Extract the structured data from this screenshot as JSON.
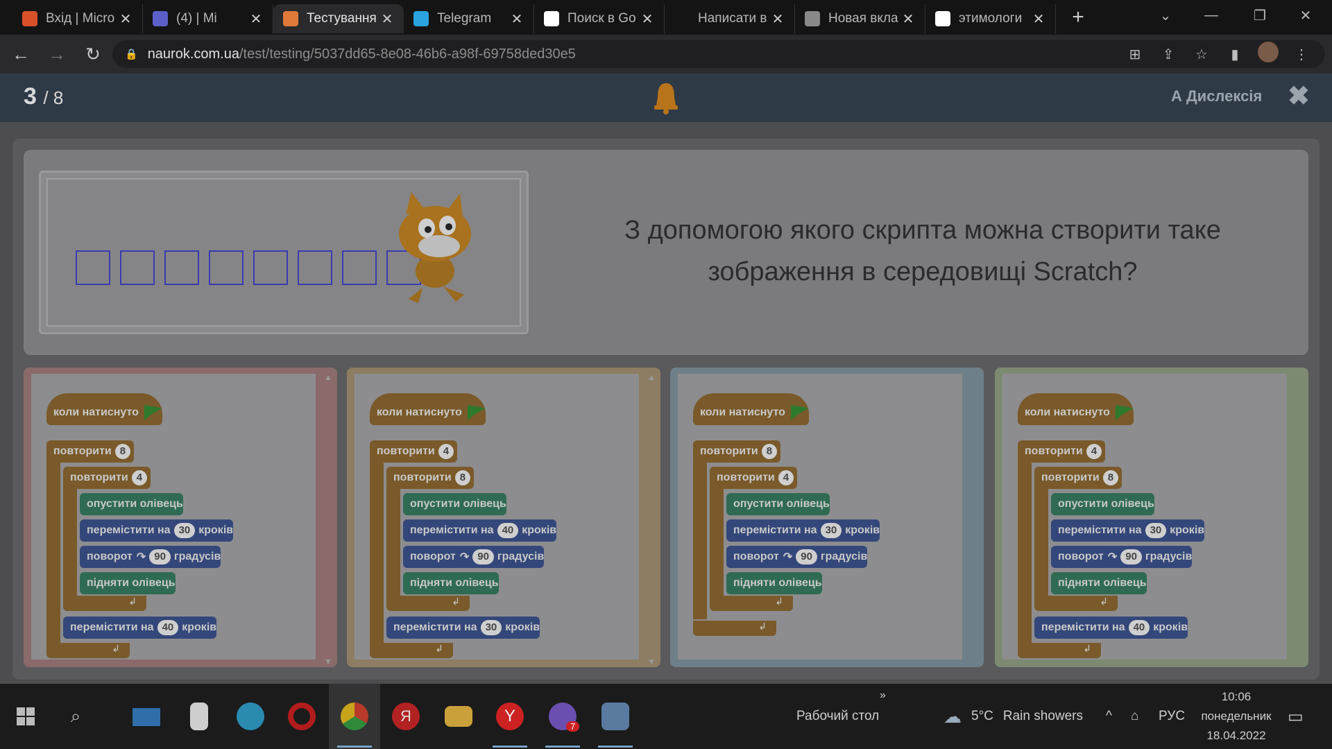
{
  "browser": {
    "tabs": [
      {
        "title": "Вхід | Micro",
        "icon": "microsoft-icon",
        "color": "#d8512b",
        "active": false
      },
      {
        "title": "(4) | Mi",
        "icon": "teams-icon",
        "color": "#5b5fc7",
        "active": false
      },
      {
        "title": "Тестування",
        "icon": "naurok-icon",
        "color": "#e07a3a",
        "active": true
      },
      {
        "title": "Telegram",
        "icon": "telegram-icon",
        "color": "#2aa3df",
        "active": false
      },
      {
        "title": "Поиск в Go",
        "icon": "google-icon",
        "color": "#ffffff",
        "active": false
      },
      {
        "title": "Написати в",
        "icon": "page-3-icon",
        "color": "#141414",
        "active": false
      },
      {
        "title": "Новая вкла",
        "icon": "chrome-icon",
        "color": "#888888",
        "active": false
      },
      {
        "title": "этимологи",
        "icon": "google-icon",
        "color": "#ffffff",
        "active": false
      }
    ],
    "url_domain": "naurok.com.ua",
    "url_path": "/test/testing/5037dd65-8e08-46b6-a98f-69758ded30e5"
  },
  "quiz": {
    "current": "3",
    "total": "/ 8",
    "dyslexia_label": "А Дислексія",
    "question": "З допомогою якого скрипта можна створити таке зображення в середовищі Scratch?",
    "answers": [
      {
        "border": "#8a6a6a",
        "hat": "коли натиснуто",
        "outer_repeat": "8",
        "pen_down": "опустити олівець",
        "inner_repeat": "4",
        "move": "30",
        "turn": "90",
        "pen_up": "підняти олівець",
        "after_move": "40"
      },
      {
        "border": "#8d7d62",
        "hat": "коли натиснуто",
        "outer_repeat": "4",
        "inner_repeat": "8",
        "pen_down": "опустити олівець",
        "move": "40",
        "turn": "90",
        "pen_up": "підняти олівець",
        "after_move": "30"
      },
      {
        "border": "#6e7f89",
        "hat": "коли натиснуто",
        "outer_repeat": "8",
        "inner_repeat": "4",
        "pen_down": "опустити олівець",
        "move": "30",
        "turn": "90",
        "pen_up": "підняти олівець"
      },
      {
        "border": "#7d8a72",
        "hat": "коли натиснуто",
        "outer_repeat": "4",
        "inner_repeat": "8",
        "pen_down": "опустити олівець",
        "move": "30",
        "turn": "90",
        "pen_up": "підняти олівець",
        "after_move": "40"
      }
    ],
    "labels": {
      "repeat": "повторити",
      "move_prefix": "перемістити на",
      "move_suffix": "кроків",
      "turn_prefix": "поворот",
      "turn_suffix": "градусів"
    }
  },
  "taskbar": {
    "desktop_label": "Рабочий стол",
    "temperature": "5°C",
    "weather": "Rain showers",
    "language": "РУС",
    "time": "10:06",
    "day": "понедельник",
    "date": "18.04.2022",
    "viber_badge": "7"
  }
}
